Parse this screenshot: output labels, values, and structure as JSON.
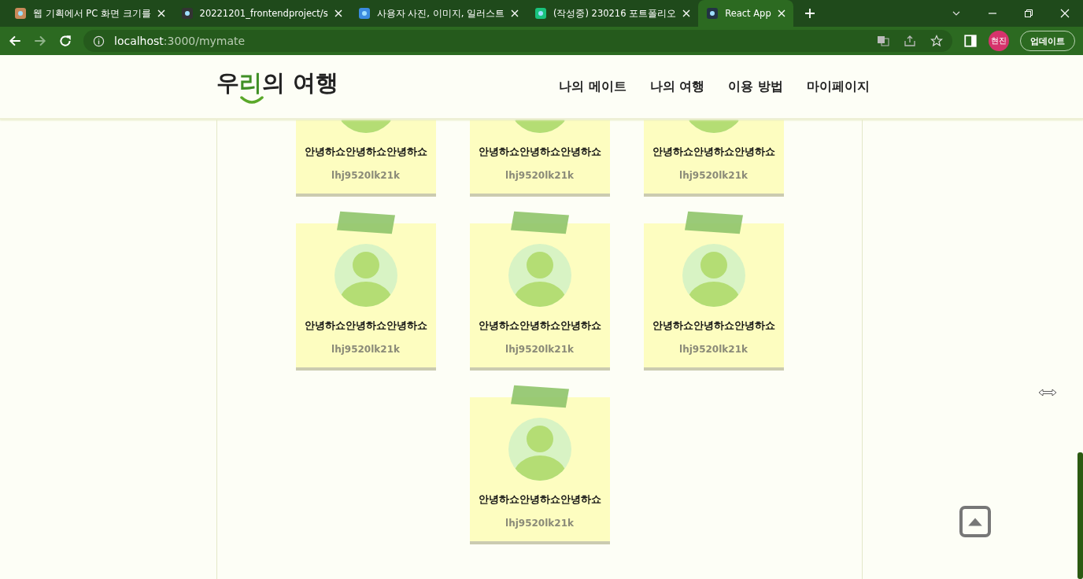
{
  "browser": {
    "tabs": [
      {
        "title": "웹 기획에서 PC 화면 크기를",
        "selected": false
      },
      {
        "title": "20221201_frontendproject/s",
        "selected": false
      },
      {
        "title": "사용자 사진, 이미지, 일러스트",
        "selected": false
      },
      {
        "title": "(작성중) 230216 포트폴리오",
        "selected": false
      },
      {
        "title": "React App",
        "selected": true
      }
    ],
    "url": {
      "host": "localhost",
      "path": ":3000/mymate"
    },
    "profile": "현진",
    "update_button": "업데이트"
  },
  "header": {
    "logo": [
      {
        "text": "우",
        "accent": false
      },
      {
        "text": "리",
        "accent": true
      },
      {
        "text": "의 여행",
        "accent": false
      }
    ],
    "nav": [
      "나의 메이트",
      "나의 여행",
      "이용 방법",
      "마이페이지"
    ]
  },
  "mates": [
    {
      "name": "안녕하쇼안녕하쇼안녕하쇼",
      "id": "lhj9520lk21k"
    },
    {
      "name": "안녕하쇼안녕하쇼안녕하쇼",
      "id": "lhj9520lk21k"
    },
    {
      "name": "안녕하쇼안녕하쇼안녕하쇼",
      "id": "lhj9520lk21k"
    },
    {
      "name": "안녕하쇼안녕하쇼안녕하쇼",
      "id": "lhj9520lk21k"
    },
    {
      "name": "안녕하쇼안녕하쇼안녕하쇼",
      "id": "lhj9520lk21k"
    },
    {
      "name": "안녕하쇼안녕하쇼안녕하쇼",
      "id": "lhj9520lk21k"
    },
    {
      "name": "안녕하쇼안녕하쇼안녕하쇼",
      "id": "lhj9520lk21k"
    }
  ]
}
